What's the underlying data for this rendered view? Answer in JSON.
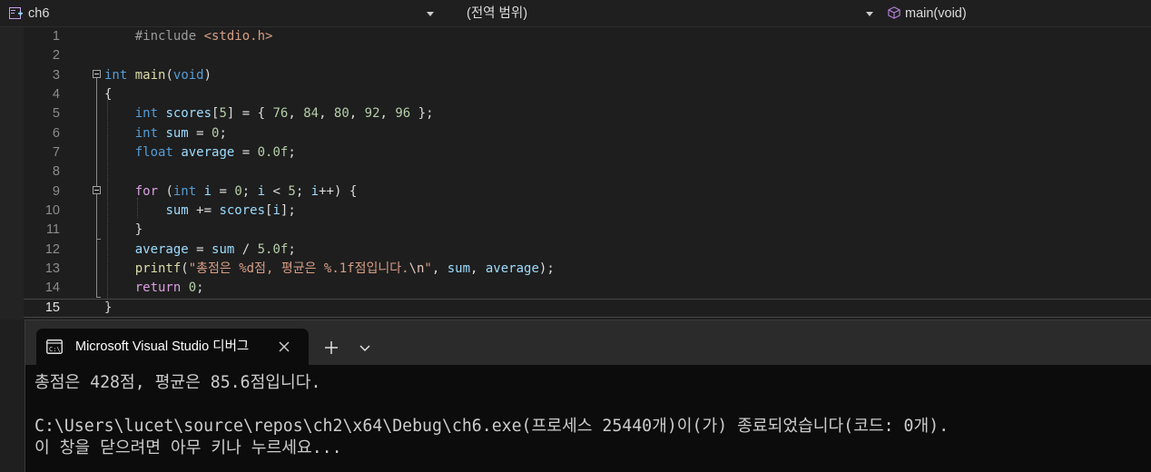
{
  "navbar": {
    "project": "ch6",
    "scope": "(전역 범위)",
    "member": "main(void)"
  },
  "editor": {
    "current_line": 15,
    "lines": [
      {
        "number": "1",
        "tokens": [
          {
            "t": "pp",
            "v": "    #include "
          },
          {
            "t": "inc",
            "v": "<stdio.h>"
          }
        ]
      },
      {
        "number": "2",
        "tokens": []
      },
      {
        "number": "3",
        "tokens": [
          {
            "t": "kw",
            "v": "int"
          },
          {
            "t": "fn",
            "v": " main"
          },
          {
            "t": "p",
            "v": "("
          },
          {
            "t": "kw",
            "v": "void"
          },
          {
            "t": "p",
            "v": ")"
          }
        ]
      },
      {
        "number": "4",
        "tokens": [
          {
            "t": "p",
            "v": "{"
          }
        ]
      },
      {
        "number": "5",
        "tokens": [
          {
            "t": "p",
            "v": "    "
          },
          {
            "t": "kw",
            "v": "int"
          },
          {
            "t": "p",
            "v": " "
          },
          {
            "t": "var",
            "v": "scores"
          },
          {
            "t": "p",
            "v": "["
          },
          {
            "t": "num",
            "v": "5"
          },
          {
            "t": "p",
            "v": "] = { "
          },
          {
            "t": "num",
            "v": "76"
          },
          {
            "t": "p",
            "v": ", "
          },
          {
            "t": "num",
            "v": "84"
          },
          {
            "t": "p",
            "v": ", "
          },
          {
            "t": "num",
            "v": "80"
          },
          {
            "t": "p",
            "v": ", "
          },
          {
            "t": "num",
            "v": "92"
          },
          {
            "t": "p",
            "v": ", "
          },
          {
            "t": "num",
            "v": "96"
          },
          {
            "t": "p",
            "v": " };"
          }
        ]
      },
      {
        "number": "6",
        "tokens": [
          {
            "t": "p",
            "v": "    "
          },
          {
            "t": "kw",
            "v": "int"
          },
          {
            "t": "p",
            "v": " "
          },
          {
            "t": "var",
            "v": "sum"
          },
          {
            "t": "p",
            "v": " = "
          },
          {
            "t": "num",
            "v": "0"
          },
          {
            "t": "p",
            "v": ";"
          }
        ]
      },
      {
        "number": "7",
        "tokens": [
          {
            "t": "p",
            "v": "    "
          },
          {
            "t": "kw",
            "v": "float"
          },
          {
            "t": "p",
            "v": " "
          },
          {
            "t": "var",
            "v": "average"
          },
          {
            "t": "p",
            "v": " = "
          },
          {
            "t": "num",
            "v": "0.0f"
          },
          {
            "t": "p",
            "v": ";"
          }
        ]
      },
      {
        "number": "8",
        "tokens": []
      },
      {
        "number": "9",
        "tokens": [
          {
            "t": "p",
            "v": "    "
          },
          {
            "t": "ctl",
            "v": "for"
          },
          {
            "t": "p",
            "v": " ("
          },
          {
            "t": "kw",
            "v": "int"
          },
          {
            "t": "p",
            "v": " "
          },
          {
            "t": "var",
            "v": "i"
          },
          {
            "t": "p",
            "v": " = "
          },
          {
            "t": "num",
            "v": "0"
          },
          {
            "t": "p",
            "v": "; "
          },
          {
            "t": "var",
            "v": "i"
          },
          {
            "t": "p",
            "v": " < "
          },
          {
            "t": "num",
            "v": "5"
          },
          {
            "t": "p",
            "v": "; "
          },
          {
            "t": "var",
            "v": "i"
          },
          {
            "t": "p",
            "v": "++) {"
          }
        ]
      },
      {
        "number": "10",
        "tokens": [
          {
            "t": "p",
            "v": "        "
          },
          {
            "t": "var",
            "v": "sum"
          },
          {
            "t": "p",
            "v": " += "
          },
          {
            "t": "var",
            "v": "scores"
          },
          {
            "t": "p",
            "v": "["
          },
          {
            "t": "var",
            "v": "i"
          },
          {
            "t": "p",
            "v": "];"
          }
        ]
      },
      {
        "number": "11",
        "tokens": [
          {
            "t": "p",
            "v": "    }"
          }
        ]
      },
      {
        "number": "12",
        "tokens": [
          {
            "t": "p",
            "v": "    "
          },
          {
            "t": "var",
            "v": "average"
          },
          {
            "t": "p",
            "v": " = "
          },
          {
            "t": "var",
            "v": "sum"
          },
          {
            "t": "p",
            "v": " / "
          },
          {
            "t": "num",
            "v": "5.0f"
          },
          {
            "t": "p",
            "v": ";"
          }
        ]
      },
      {
        "number": "13",
        "tokens": [
          {
            "t": "p",
            "v": "    "
          },
          {
            "t": "fn",
            "v": "printf"
          },
          {
            "t": "p",
            "v": "("
          },
          {
            "t": "str",
            "v": "\"총점은 %d점, 평균은 %.1f점입니다."
          },
          {
            "t": "esc",
            "v": "\\n"
          },
          {
            "t": "str",
            "v": "\""
          },
          {
            "t": "p",
            "v": ", "
          },
          {
            "t": "var",
            "v": "sum"
          },
          {
            "t": "p",
            "v": ", "
          },
          {
            "t": "var",
            "v": "average"
          },
          {
            "t": "p",
            "v": ");"
          }
        ]
      },
      {
        "number": "14",
        "tokens": [
          {
            "t": "p",
            "v": "    "
          },
          {
            "t": "ctl",
            "v": "return"
          },
          {
            "t": "p",
            "v": " "
          },
          {
            "t": "num",
            "v": "0"
          },
          {
            "t": "p",
            "v": ";"
          }
        ]
      },
      {
        "number": "15",
        "tokens": [
          {
            "t": "p",
            "v": "}"
          }
        ]
      }
    ]
  },
  "terminal": {
    "tab_title": "Microsoft Visual Studio 디버그",
    "tab_icon": "console-icon",
    "new_tab_label": "+",
    "output": [
      "총점은 428점, 평균은 85.6점입니다.",
      "",
      "C:\\Users\\lucet\\source\\repos\\ch2\\x64\\Debug\\ch6.exe(프로세스 25440개)이(가) 종료되었습니다(코드: 0개).",
      "이 창을 닫으려면 아무 키나 누르세요..."
    ]
  },
  "colors": {
    "keyword": "#569cd6",
    "variable": "#9cdcfe",
    "number": "#b5cea8",
    "string": "#d69d85",
    "function": "#dcdcaa",
    "control": "#d8a0df",
    "preprocessor": "#9b9b9b",
    "terminal_bg": "#0c0c0c",
    "tabbar_bg": "#2b2b2b"
  }
}
